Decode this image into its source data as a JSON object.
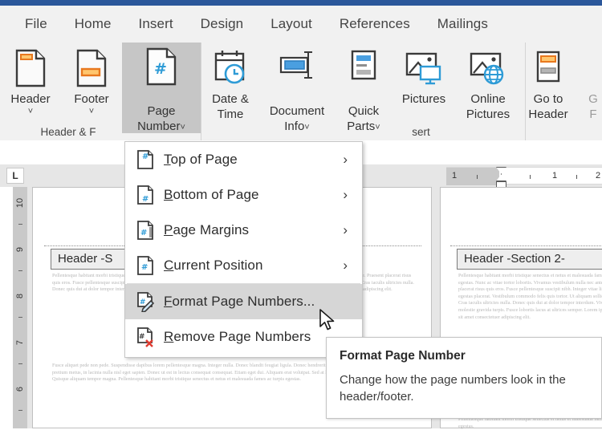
{
  "app": {
    "titlebar_color": "#2b579a",
    "ribbon_bg": "#f1f1f1",
    "selected_color": "#c6c6c6",
    "menu_highlight": "#d6d6d6"
  },
  "tabs": [
    {
      "label": "File"
    },
    {
      "label": "Home"
    },
    {
      "label": "Insert"
    },
    {
      "label": "Design"
    },
    {
      "label": "Layout"
    },
    {
      "label": "References"
    },
    {
      "label": "Mailings"
    }
  ],
  "ribbon": {
    "groups": [
      {
        "title": "Header & F",
        "buttons": [
          {
            "name": "header",
            "label": "Header",
            "icon": "header-icon",
            "caret": "˅",
            "selected": false
          },
          {
            "name": "footer",
            "label": "Footer",
            "icon": "footer-icon",
            "caret": "˅",
            "selected": false
          },
          {
            "name": "page-number",
            "label": "Page\nNumber",
            "icon": "page-number-icon",
            "caret": "˅",
            "inline_caret": true,
            "selected": true
          }
        ]
      },
      {
        "title": "sert",
        "buttons": [
          {
            "name": "date-and-time",
            "label": "Date &\nTime",
            "icon": "calendar-clock-icon",
            "selected": false
          },
          {
            "name": "document-info",
            "label": "Document\nInfo",
            "icon": "document-info-icon",
            "caret": "˅",
            "inline_caret": true,
            "selected": false
          },
          {
            "name": "quick-parts",
            "label": "Quick\nParts",
            "icon": "quick-parts-icon",
            "caret": "˅",
            "inline_caret": true,
            "selected": false
          },
          {
            "name": "pictures",
            "label": "Pictures",
            "icon": "pictures-icon",
            "selected": false
          },
          {
            "name": "online-pictures",
            "label": "Online\nPictures",
            "icon": "online-pictures-icon",
            "selected": false
          }
        ]
      },
      {
        "title": "",
        "buttons": [
          {
            "name": "go-to-header",
            "label": "Go to\nHeader",
            "icon": "go-to-header-icon",
            "selected": false
          },
          {
            "name": "go-to-footer",
            "label": "G\nF",
            "icon": "go-to-footer-icon",
            "clipped": true,
            "selected": false
          }
        ]
      }
    ]
  },
  "ruler": {
    "tab_selector": "L",
    "horizontal_labels": [
      "1",
      "1",
      "2"
    ],
    "vertical_labels": [
      "10",
      "9",
      "8",
      "7",
      "6"
    ]
  },
  "document": {
    "left_page_header": "Header -S",
    "right_page_header": "Header -Section 2-",
    "body_paragraph_1": "Pellentesque habitant morbi tristique senectus et netus et malesuada fames ac turpis egestas. Nunc ac vitae tortor lobortis. Vivamus vestibulum nulla nec ante. Praesent placerat risus quis eros. Fusce pellentesque suscipit nibh. Integer vitae libero ac risus egestas placerat. Vestibulum commodo felis quis tortor. Ut aliquam sollicitudin leo. Cras iaculis ultricies nulla. Donec quis dui at dolor tempor interdum. Vivamus molestie gravida turpis. Fusce lobortis lacus at ultrices semper. Lorem ipsum dolor sit amet consectetuer adipiscing elit.",
    "body_paragraph_2": "Fusce aliquet pede non pede. Suspendisse dapibus lorem pellentesque magna. Integer nulla. Donec blandit feugiat ligula. Donec hendrerit, felis et imperdiet euismod, purus ipsum pretium metus, in lacinia nulla nisl eget sapien. Donec ut est in lectus consequat consequat. Etiam eget dui. Aliquam erat volutpat. Sed at lorem in nunc porta tristique. Proin nec augue. Quisque aliquam tempor magna. Pellentesque habitant morbi tristique senectus et netus et malesuada fames ac turpis egestas."
  },
  "menu": {
    "items": [
      {
        "name": "top-of-page",
        "label": "Top of Page",
        "accel": "T",
        "icon": "page-number-top-icon",
        "submenu": true,
        "highlighted": false
      },
      {
        "name": "bottom-of-page",
        "label": "Bottom of Page",
        "accel": "B",
        "icon": "page-number-bottom-icon",
        "submenu": true,
        "highlighted": false
      },
      {
        "name": "page-margins",
        "label": "Page Margins",
        "accel": "P",
        "icon": "page-number-margins-icon",
        "submenu": true,
        "highlighted": false
      },
      {
        "name": "current-position",
        "label": "Current Position",
        "accel": "C",
        "icon": "page-number-position-icon",
        "submenu": true,
        "highlighted": false
      },
      {
        "separator": true
      },
      {
        "name": "format-page-numbers",
        "label": "Format Page Numbers...",
        "accel": "F",
        "icon": "format-page-numbers-icon",
        "submenu": false,
        "highlighted": true
      },
      {
        "name": "remove-page-numbers",
        "label": "Remove Page Numbers",
        "accel": "R",
        "icon": "remove-page-numbers-icon",
        "submenu": false,
        "highlighted": false
      }
    ],
    "submenu_arrow": "›"
  },
  "tooltip": {
    "title": "Format Page Number",
    "body": "Change how the page numbers look in the header/footer."
  }
}
